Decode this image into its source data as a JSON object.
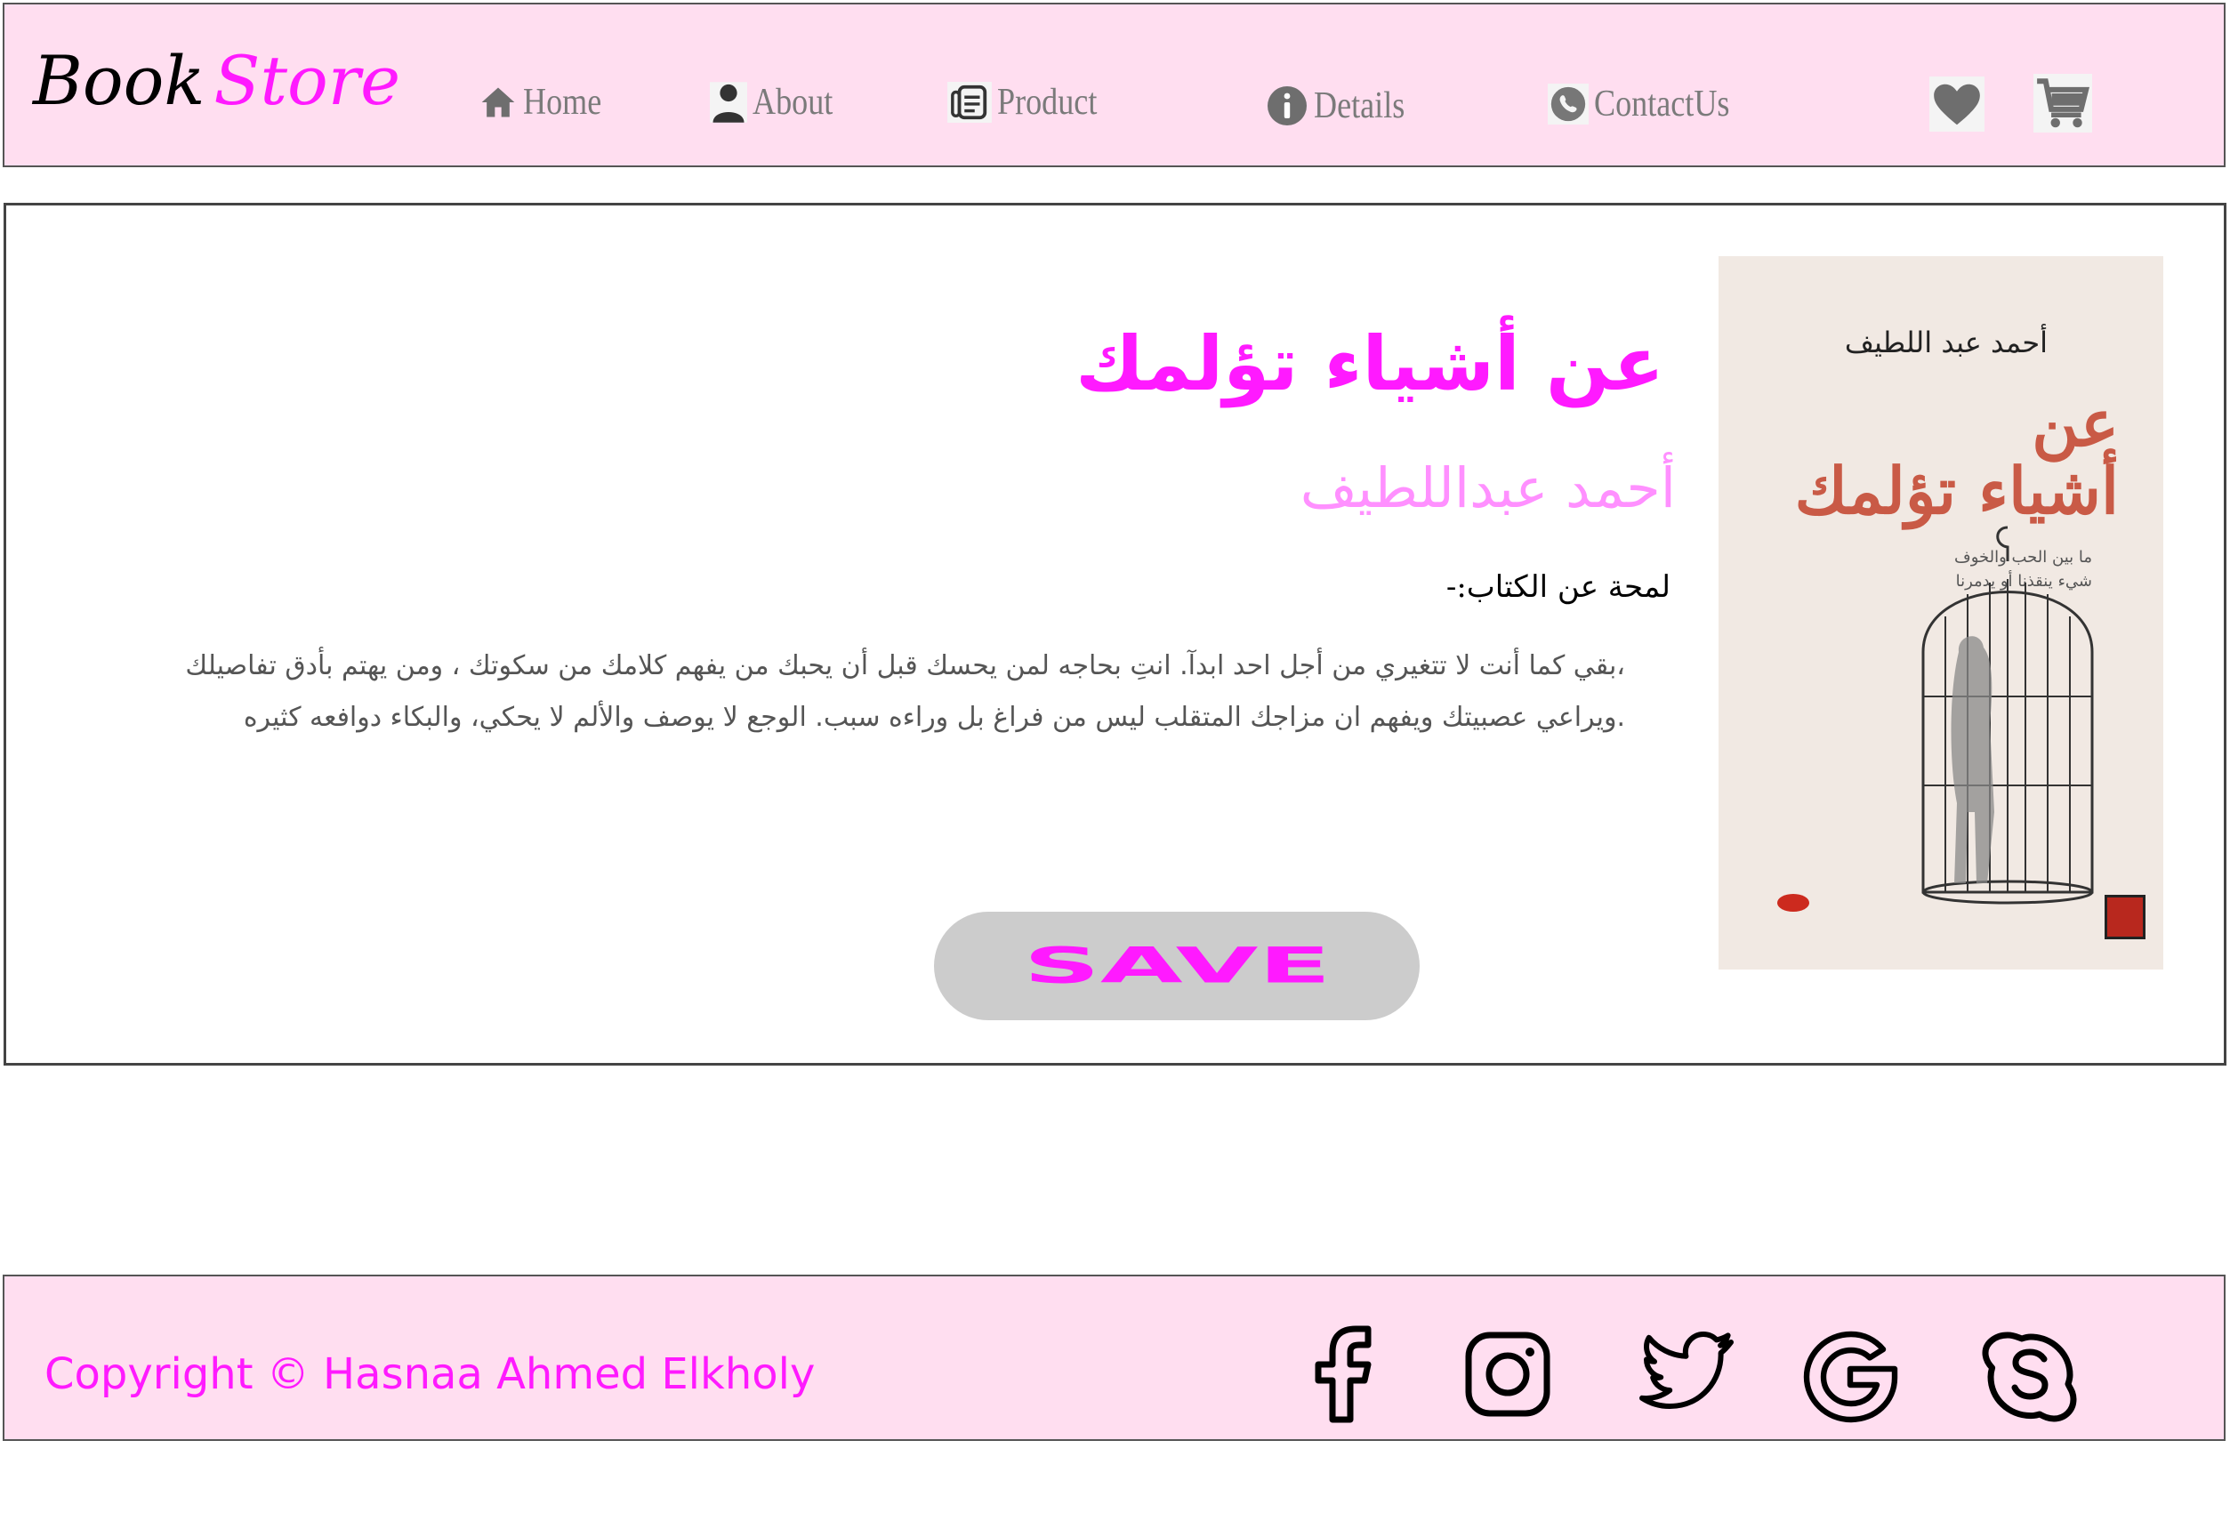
{
  "header": {
    "logo": {
      "part1": "Book",
      "part2": "Store"
    },
    "nav": [
      {
        "label": "Home",
        "icon": "home-icon"
      },
      {
        "label": "About",
        "icon": "person-icon"
      },
      {
        "label": "Product",
        "icon": "document-icon"
      },
      {
        "label": "Details",
        "icon": "info-icon"
      },
      {
        "label": "ContactUs",
        "icon": "phone-icon"
      }
    ],
    "actions": [
      "heart-icon",
      "cart-icon"
    ]
  },
  "book": {
    "cover": {
      "author": "أحمد عبد اللطيف",
      "title_line1": "عن",
      "title_line2": "أشياء تؤلمك",
      "subtitle_line1": "ما بين الحب والخوف",
      "subtitle_line2": "شيء ينقذنا أو يدمرنا"
    },
    "title": "عن أشياء تؤلمك",
    "author": "أحمد عبداللطيف",
    "about_label": "لمحة عن الكتاب:-",
    "description_line1": "،بقي كما أنت لا تتغيري من أجل احد ابدآ. انتِ بحاجه لمن يحسك قبل أن يحبك من يفهم كلامك من سكوتك ، ومن يهتم بأدق تفاصيلك",
    "description_line2": ".ويراعي عصبيتك ويفهم ان مزاجك المتقلب ليس من فراغ بل وراءه سبب. الوجع لا يوصف والألم لا يحكي، والبكاء دوافعه كثيره",
    "save_label": "SAVE"
  },
  "footer": {
    "copyright": "Copyright © Hasnaa Ahmed Elkholy",
    "social": [
      "facebook-icon",
      "instagram-icon",
      "twitter-icon",
      "google-icon",
      "skype-icon"
    ]
  },
  "colors": {
    "brand_pink": "#ff1aff",
    "light_pink": "#ff90ff",
    "header_bg": "#ffdef0",
    "nav_text": "#7a7a7a",
    "button_bg": "#cccccc"
  }
}
